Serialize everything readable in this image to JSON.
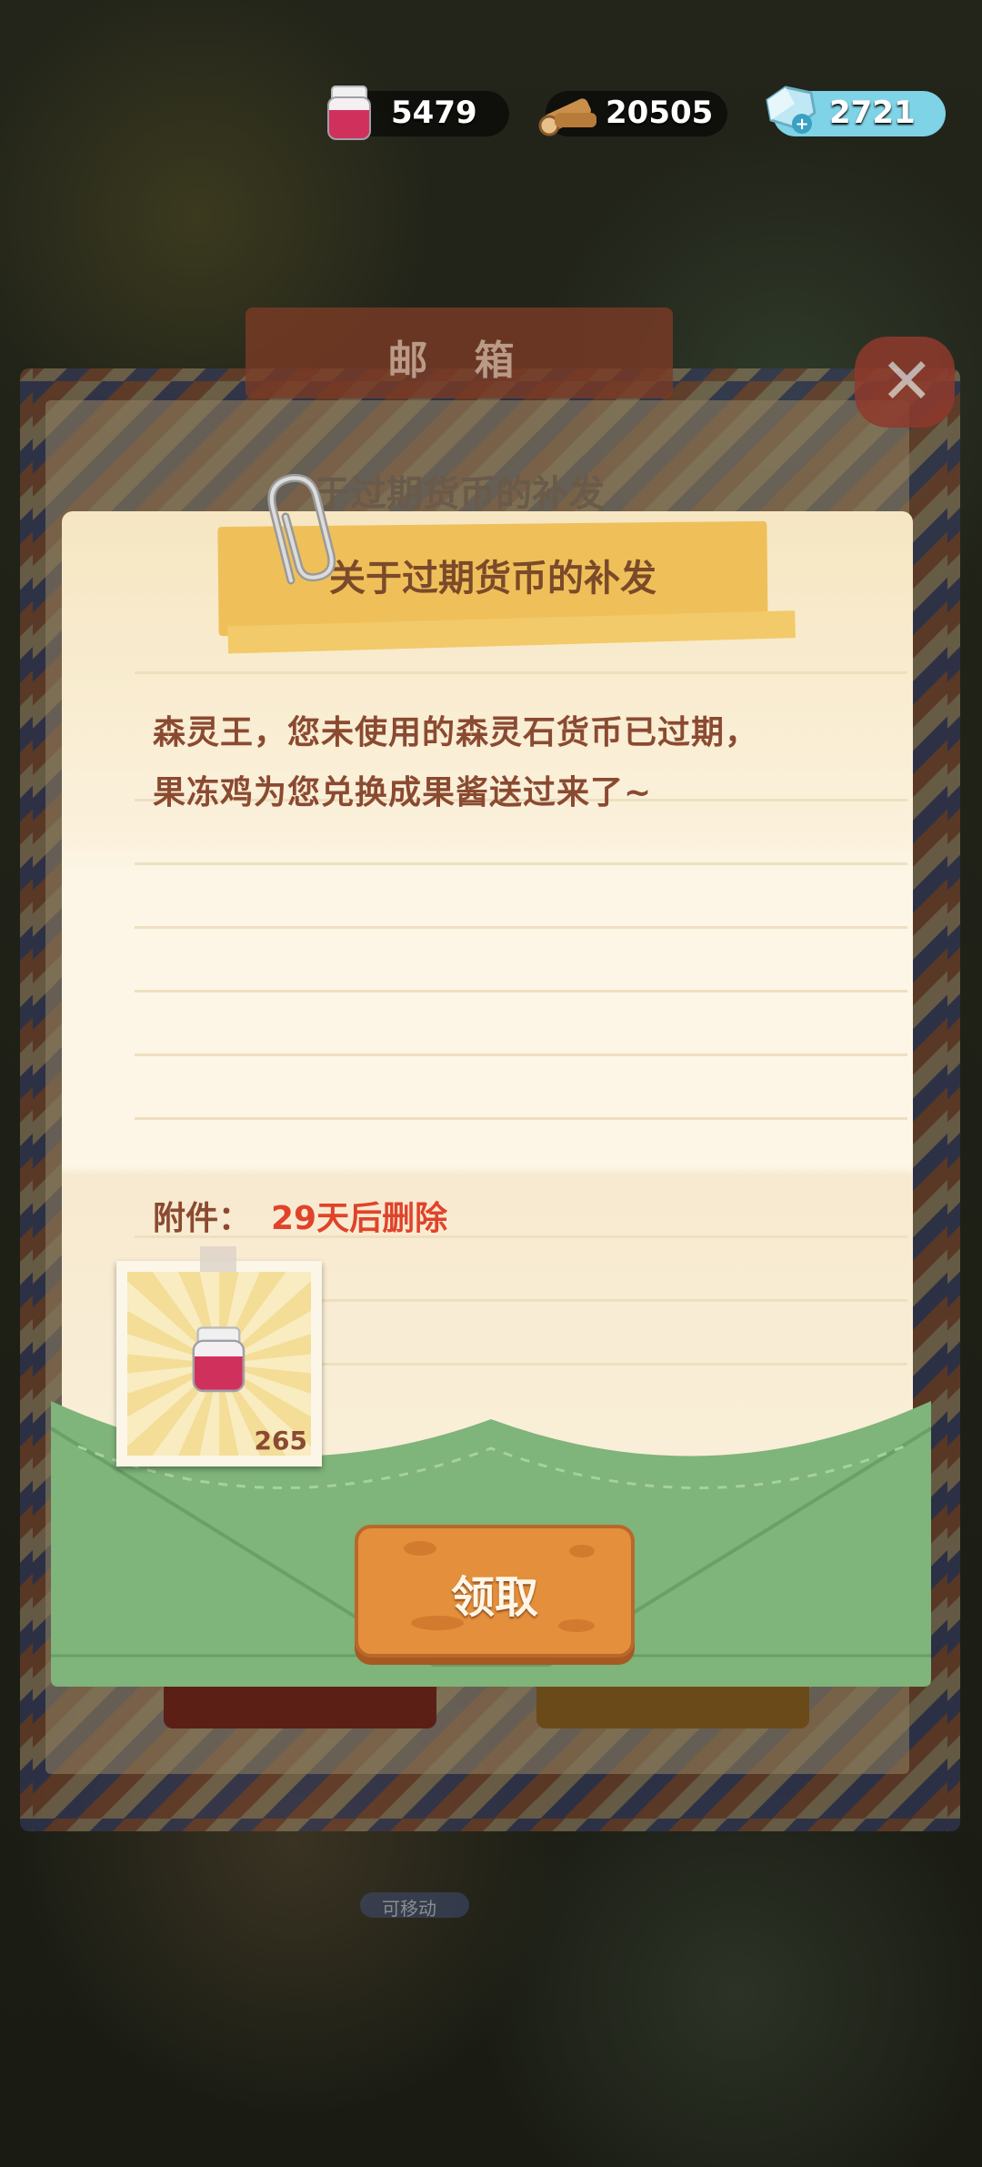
{
  "resources": {
    "jam": {
      "icon": "jam-jar-icon",
      "value": "5479"
    },
    "wood": {
      "icon": "wood-log-icon",
      "value": "20505"
    },
    "gem": {
      "icon": "gem-plus-icon",
      "value": "2721"
    }
  },
  "mailbox": {
    "title": "邮 箱",
    "ghost_item_title": "于过期货币的补发",
    "badge": "可移动"
  },
  "letter": {
    "title": "关于过期货币的补发",
    "body_lines": [
      "森灵王，您未使用的森灵石货币已过期，",
      "果冻鸡为您兑换成果酱送过来了~"
    ],
    "attachment_label": "附件：",
    "attachment_expire": "29天后删除",
    "attachment_item": {
      "icon": "jam-jar-icon",
      "count": "265"
    }
  },
  "actions": {
    "claim_label": "领取",
    "close_symbol": "✕"
  },
  "colors": {
    "banner": "#efc05a",
    "envelope": "#7fb47a",
    "claim_button": "#e48f3b",
    "expire_text": "#e0432a"
  }
}
